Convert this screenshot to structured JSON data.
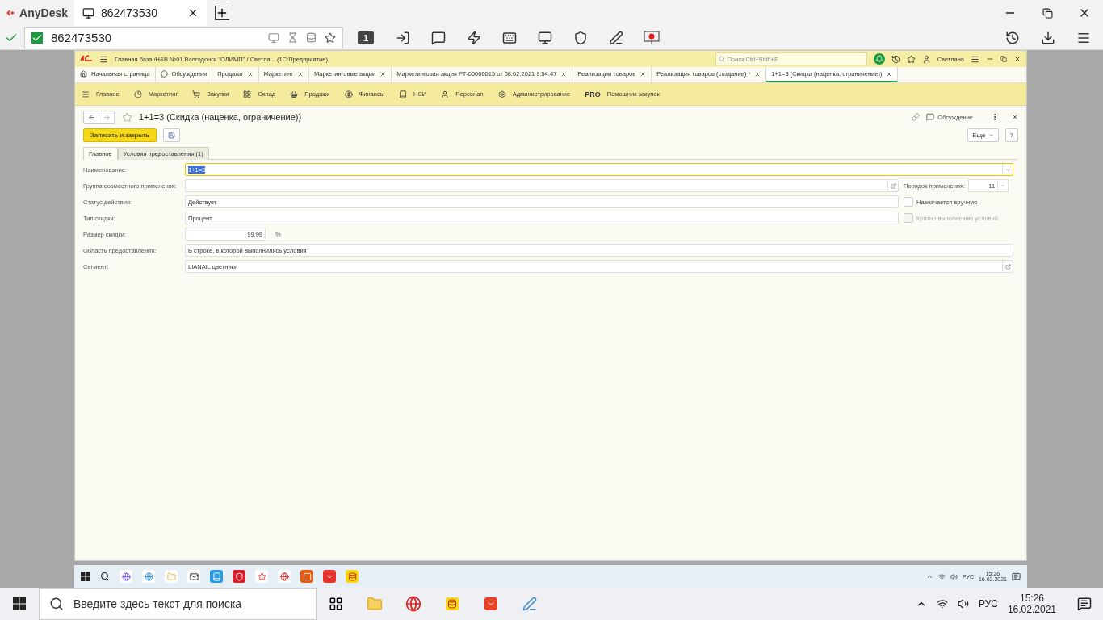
{
  "anydesk": {
    "app_name": "AnyDesk",
    "tab": {
      "label": "862473530"
    },
    "address": "862473530",
    "monitor": "1"
  },
  "onec": {
    "title": "Главная база /Н&В №01 Волгодонск \"ОЛИМП\" / Светла...  (1С:Предприятие)",
    "search": {
      "placeholder": "Поиск Ctrl+Shift+F"
    },
    "user": "Светлана",
    "open_tabs": [
      {
        "label": "Начальная страница",
        "closable": false,
        "selected": false
      },
      {
        "label": "Обсуждения",
        "closable": false,
        "selected": false
      },
      {
        "label": "Продажи",
        "closable": true,
        "selected": false
      },
      {
        "label": "Маркетинг",
        "closable": true,
        "selected": false
      },
      {
        "label": "Маркетинговые акции",
        "closable": true,
        "selected": false
      },
      {
        "label": "Маркетинговая акция РТ-00000015 от 08.02.2021 9:54:47",
        "closable": true,
        "selected": false
      },
      {
        "label": "Реализации товаров",
        "closable": true,
        "selected": false
      },
      {
        "label": "Реализация товаров (создание) *",
        "closable": true,
        "selected": false
      },
      {
        "label": "1+1=3 (Скидка (наценка, ограничение))",
        "closable": true,
        "selected": true
      }
    ],
    "sections": [
      {
        "label": "Главное"
      },
      {
        "label": "Маркетинг"
      },
      {
        "label": "Закупки"
      },
      {
        "label": "Склад"
      },
      {
        "label": "Продажи"
      },
      {
        "label": "Финансы"
      },
      {
        "label": "НСИ"
      },
      {
        "label": "Персонал"
      },
      {
        "label": "Администрирование"
      },
      {
        "label": "Помощник закупок",
        "badge": "PRO"
      }
    ],
    "form": {
      "title": "1+1=3 (Скидка (наценка, ограничение))",
      "discussion": "Обсуждение",
      "save_close": "Записать и закрыть",
      "more": "Еще",
      "help": "?",
      "tabs": [
        {
          "label": "Главное",
          "selected": true
        },
        {
          "label": "Условия предоставления (1)",
          "selected": false
        }
      ],
      "fields": [
        {
          "kind": "select",
          "label": "Наименование:",
          "value": "1+1=3",
          "focused": true
        },
        {
          "kind": "open",
          "label": "Группа совместного применения:",
          "side": {
            "kind": "spinner",
            "label": "Порядок применения:",
            "value": "11"
          }
        },
        {
          "kind": "text",
          "label": "Статус действия:",
          "value": "Действует",
          "side": {
            "kind": "checkbox",
            "label": "Назначается вручную",
            "checked": false,
            "disabled": false
          }
        },
        {
          "kind": "text",
          "label": "Тип скидки:",
          "value": "Процент",
          "side": {
            "kind": "checkbox",
            "label": "Кратно выполнению условий",
            "checked": false,
            "disabled": true
          }
        },
        {
          "kind": "number",
          "label": "Размер скидки:",
          "value": "99,99",
          "unit": "%"
        },
        {
          "kind": "text",
          "label": "Область предоставления:",
          "value": "В строке, в которой выполнились условия"
        },
        {
          "kind": "open",
          "label": "Сегмент:",
          "value": "LIANAIL цветники"
        }
      ]
    }
  },
  "remote_taskbar": {
    "lang": "РУС",
    "time": "15:26",
    "date": "16.02.2021"
  },
  "taskbar": {
    "search": {
      "placeholder": "Введите здесь текст для поиска"
    },
    "lang": "РУС",
    "time": "15:26",
    "date": "16.02.2021"
  }
}
